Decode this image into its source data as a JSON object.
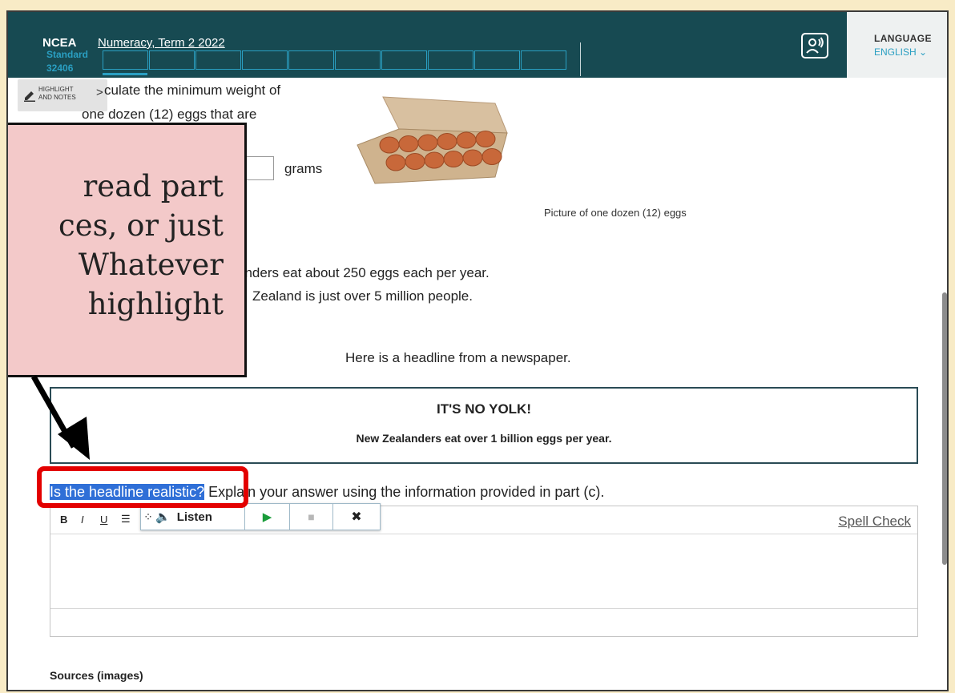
{
  "header": {
    "brand": "NCEA",
    "test_title": "Numeracy, Term 2 2022",
    "standard_label": "Standard",
    "standard_number": "32406",
    "question_count": 10,
    "language_title": "LANGUAGE",
    "language_value": "ENGLISH"
  },
  "highlight_tool": {
    "line1": "HIGHLIGHT",
    "line2": "AND NOTES"
  },
  "question_b": {
    "line1": "culate the minimum weight of",
    "line2": "one dozen (12) eggs that are",
    "unit": "grams",
    "image_caption": "Picture of one dozen (12) eggs"
  },
  "part_c": {
    "fact1": "anders eat about 250 eggs each per year.",
    "fact2": "Zealand is just over 5 million people.",
    "intro": "Here is a headline from a newspaper."
  },
  "headline": {
    "title": "IT'S NO YOLK!",
    "subtitle": "New Zealanders eat over 1 billion eggs per year."
  },
  "question": {
    "selected": "Is the headline realistic?",
    "rest": " Explain your answer using the information provided in part (c)."
  },
  "editor": {
    "bold": "B",
    "italic": "I",
    "underline": "U",
    "spell_check": "Spell Check"
  },
  "listen_bar": {
    "label": "Listen",
    "play": "▶",
    "stop": "■",
    "close": "✖"
  },
  "sources_label": "Sources (images)",
  "callout": {
    "line1": "read part",
    "line2": "ces, or just",
    "line3": "Whatever",
    "line4": "highlight"
  },
  "colors": {
    "header_bg": "#174a52",
    "accent": "#2a9fc2",
    "selection": "#2f6fd7",
    "callout_bg": "#f3c9c9",
    "annotation_red": "#e30000"
  }
}
